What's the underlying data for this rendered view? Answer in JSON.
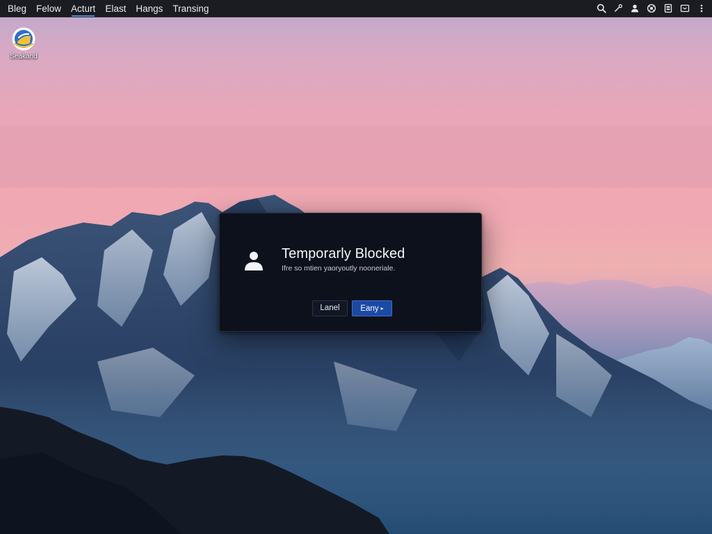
{
  "menubar": {
    "items": [
      {
        "label": "Bleg"
      },
      {
        "label": "Felow"
      },
      {
        "label": "Acturt"
      },
      {
        "label": "Elast"
      },
      {
        "label": "Hangs"
      },
      {
        "label": "Transing"
      }
    ],
    "active_index": 2,
    "tray_icons": [
      "search-icon",
      "settings-edit-icon",
      "user-icon",
      "network-icon",
      "battery-icon",
      "display-icon",
      "more-vertical-icon"
    ]
  },
  "desktop": {
    "icons": [
      {
        "label": "Seakand",
        "icon": "app-icon"
      }
    ]
  },
  "dialog": {
    "icon": "user-icon",
    "title": "Temporarly Blocked",
    "message": "Ifre so mtien yaoryoutly nooneriale.",
    "buttons": {
      "cancel": "Lanel",
      "confirm": "Eany",
      "confirm_suffix": "▸"
    },
    "colors": {
      "background": "#0c111c",
      "primary": "#1b49a6"
    }
  },
  "colors": {
    "menubar": "#1b1c21",
    "sky_top": "#b9a9cf",
    "sky_pink": "#f0a9b2",
    "mountain": "#2f4d6c"
  }
}
